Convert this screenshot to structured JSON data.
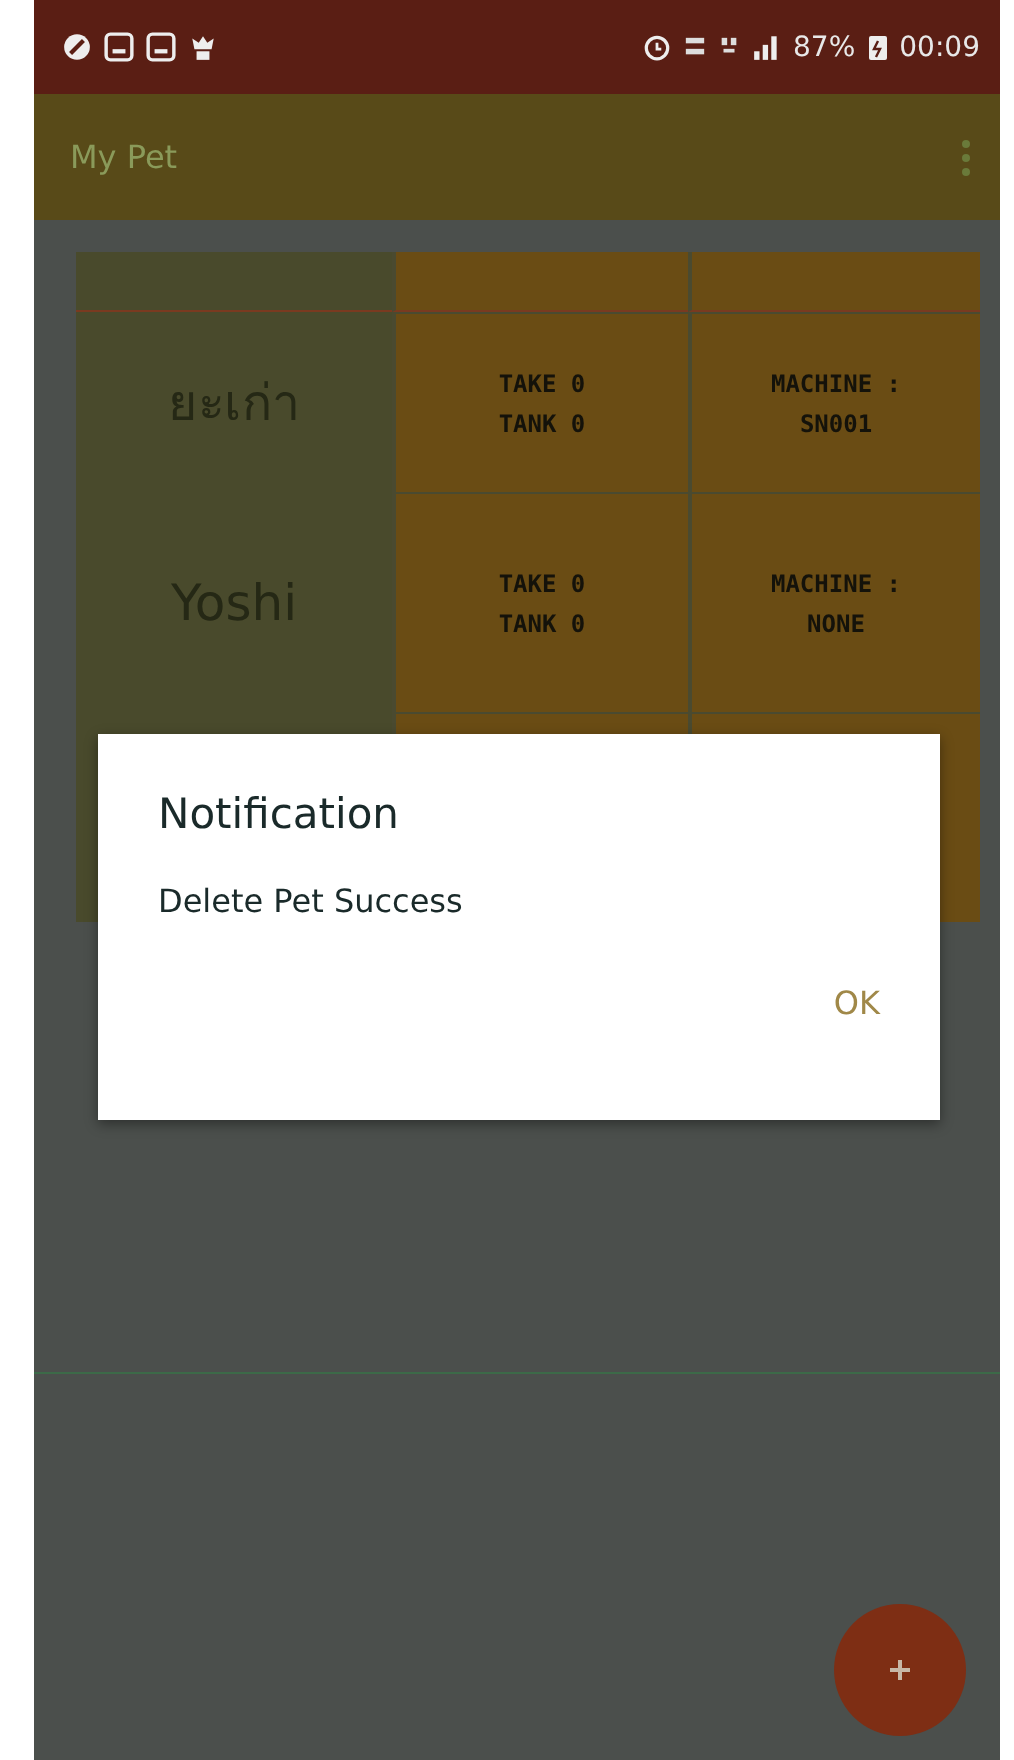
{
  "status_bar": {
    "battery": "87%",
    "time": "00:09"
  },
  "app_bar": {
    "title": "My Pet"
  },
  "pets": [
    {
      "name": "ยะเก่า",
      "take": "TAKE 0",
      "tank": "TANK 0",
      "machine_label": "MACHINE :",
      "machine": "SN001"
    },
    {
      "name": "Yoshi",
      "take": "TAKE 0",
      "tank": "TANK 0",
      "machine_label": "MACHINE :",
      "machine": "NONE"
    }
  ],
  "dialog": {
    "title": "Notification",
    "message": "Delete Pet Success",
    "button": "OK"
  }
}
